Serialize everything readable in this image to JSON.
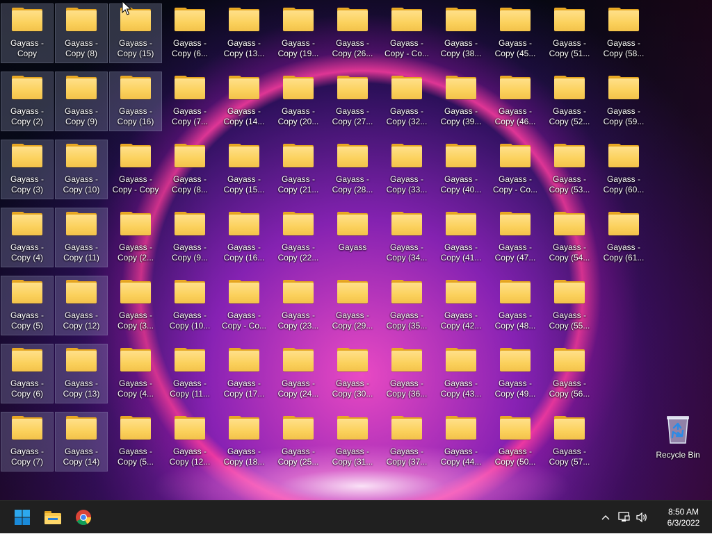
{
  "desktop": {
    "columns": [
      [
        "Gayass - Copy",
        "Gayass - Copy (2)",
        "Gayass - Copy (3)",
        "Gayass - Copy (4)",
        "Gayass - Copy (5)",
        "Gayass - Copy (6)",
        "Gayass - Copy (7)"
      ],
      [
        "Gayass - Copy (8)",
        "Gayass - Copy (9)",
        "Gayass - Copy (10)",
        "Gayass - Copy (11)",
        "Gayass - Copy (12)",
        "Gayass - Copy (13)",
        "Gayass - Copy (14)"
      ],
      [
        "Gayass - Copy (15)",
        "Gayass - Copy (16)",
        "Gayass - Copy - Copy",
        "Gayass - Copy (2...",
        "Gayass - Copy (3...",
        "Gayass - Copy (4...",
        "Gayass - Copy (5..."
      ],
      [
        "Gayass - Copy (6...",
        "Gayass - Copy (7...",
        "Gayass - Copy (8...",
        "Gayass - Copy (9...",
        "Gayass - Copy (10...",
        "Gayass - Copy (11...",
        "Gayass - Copy (12..."
      ],
      [
        "Gayass - Copy (13...",
        "Gayass - Copy (14...",
        "Gayass - Copy (15...",
        "Gayass - Copy (16...",
        "Gayass - Copy - Co...",
        "Gayass - Copy (17...",
        "Gayass - Copy (18..."
      ],
      [
        "Gayass - Copy (19...",
        "Gayass - Copy (20...",
        "Gayass - Copy (21...",
        "Gayass - Copy (22...",
        "Gayass - Copy (23...",
        "Gayass - Copy (24...",
        "Gayass - Copy (25..."
      ],
      [
        "Gayass - Copy (26...",
        "Gayass - Copy (27...",
        "Gayass - Copy (28...",
        "Gayass",
        "Gayass - Copy (29...",
        "Gayass - Copy (30...",
        "Gayass - Copy (31..."
      ],
      [
        "Gayass - Copy - Co...",
        "Gayass - Copy (32...",
        "Gayass - Copy (33...",
        "Gayass - Copy (34...",
        "Gayass - Copy (35...",
        "Gayass - Copy (36...",
        "Gayass - Copy (37..."
      ],
      [
        "Gayass - Copy (38...",
        "Gayass - Copy (39...",
        "Gayass - Copy (40...",
        "Gayass - Copy (41...",
        "Gayass - Copy (42...",
        "Gayass - Copy (43...",
        "Gayass - Copy (44..."
      ],
      [
        "Gayass - Copy (45...",
        "Gayass - Copy (46...",
        "Gayass - Copy - Co...",
        "Gayass - Copy (47...",
        "Gayass - Copy (48...",
        "Gayass - Copy (49...",
        "Gayass - Copy (50..."
      ],
      [
        "Gayass - Copy (51...",
        "Gayass - Copy (52...",
        "Gayass - Copy (53...",
        "Gayass - Copy (54...",
        "Gayass - Copy (55...",
        "Gayass - Copy (56...",
        "Gayass - Copy (57..."
      ],
      [
        "Gayass - Copy (58...",
        "Gayass - Copy (59...",
        "Gayass - Copy (60...",
        "Gayass - Copy (61..."
      ]
    ],
    "selected_columns": [
      0,
      1
    ],
    "selected_partial": {
      "column": 2,
      "rows": [
        0,
        1
      ]
    },
    "folder_icon": "folder-icon",
    "recycle_bin": {
      "label": "Recycle Bin",
      "icon": "recycle-bin-icon"
    }
  },
  "taskbar": {
    "pinned": [
      {
        "name": "start-button",
        "icon": "windows-logo-icon"
      },
      {
        "name": "file-explorer-button",
        "icon": "file-explorer-icon"
      },
      {
        "name": "chrome-button",
        "icon": "chrome-icon"
      }
    ],
    "tray": {
      "icons": [
        "chevron-up-icon",
        "network-icon",
        "volume-icon"
      ]
    },
    "clock": {
      "time": "8:50 AM",
      "date": "6/3/2022"
    }
  },
  "colors": {
    "taskbar_bg": "#202020",
    "folder_yellow": "#fbd15c",
    "folder_back": "#e5a51f",
    "selection": "#a0aac8"
  }
}
